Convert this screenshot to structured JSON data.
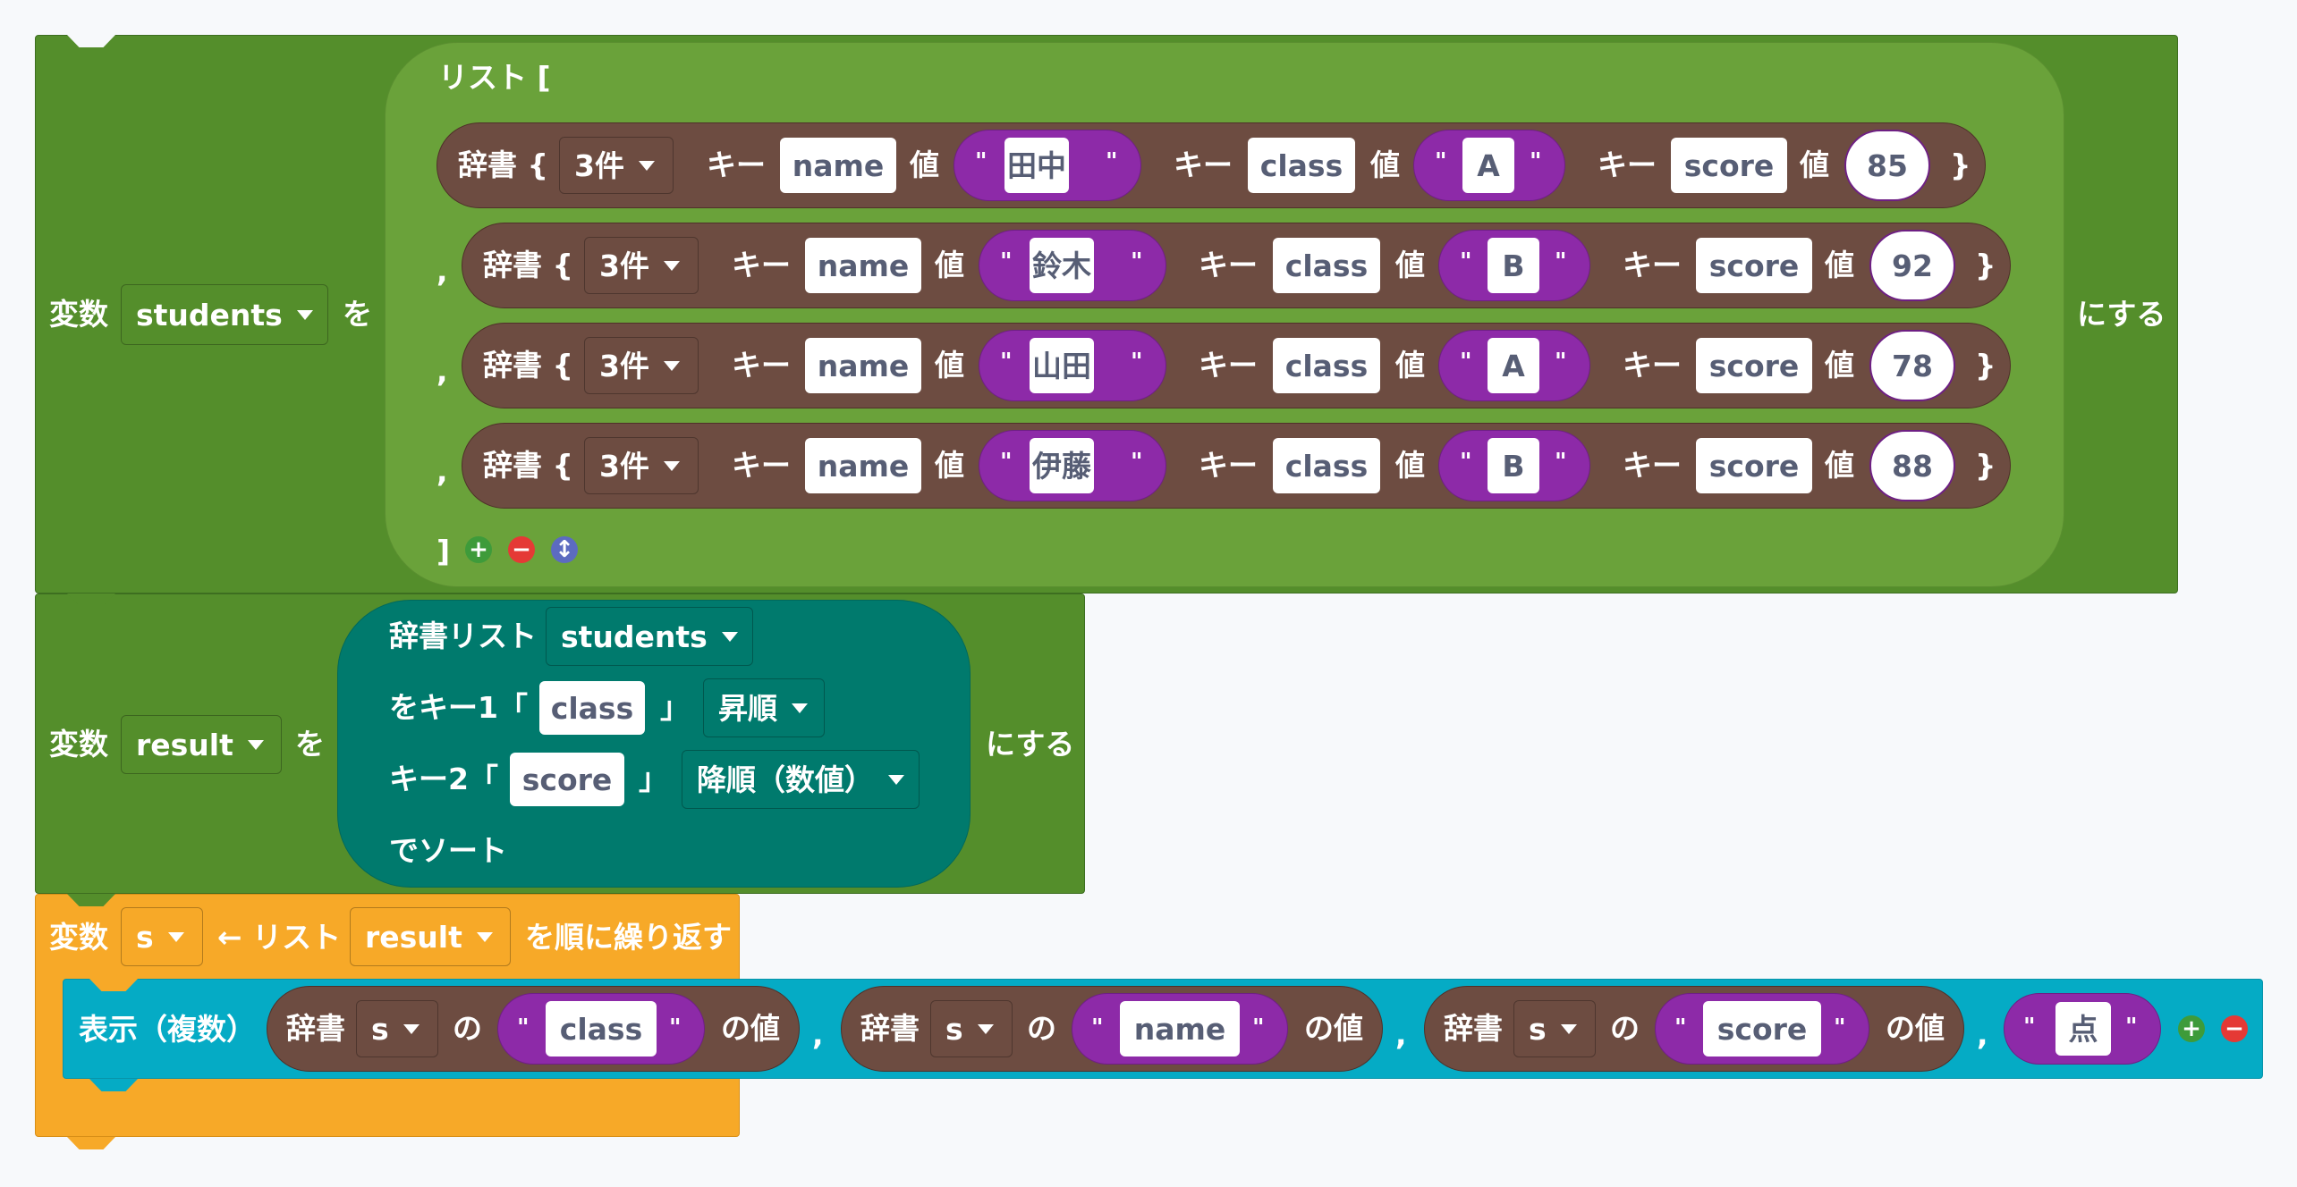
{
  "colors": {
    "variables": "#548e2b",
    "list": "#6aa23a",
    "dictionary": "#6d4c41",
    "string": "#8d2aa8",
    "sort": "#007a6d",
    "loop": "#f7a928",
    "print": "#05abc5",
    "background": "#f7f9fb"
  },
  "block1": {
    "var_label": "変数",
    "var_name": "students",
    "wo": "を",
    "nisuru": "にする",
    "list_open": "リスト [",
    "list_close": "]",
    "plus_icon": "+",
    "minus_icon": "−",
    "reorder_icon": "↕",
    "comma": ",",
    "dicts": [
      {
        "label": "辞書 {",
        "count": "3件",
        "key_label": "キー",
        "value_label": "値",
        "k1": "name",
        "v1": "田中",
        "k2": "class",
        "v2": "A",
        "k3": "score",
        "v3": "85",
        "close": "}"
      },
      {
        "label": "辞書 {",
        "count": "3件",
        "key_label": "キー",
        "value_label": "値",
        "k1": "name",
        "v1": "鈴木",
        "k2": "class",
        "v2": "B",
        "k3": "score",
        "v3": "92",
        "close": "}"
      },
      {
        "label": "辞書 {",
        "count": "3件",
        "key_label": "キー",
        "value_label": "値",
        "k1": "name",
        "v1": "山田",
        "k2": "class",
        "v2": "A",
        "k3": "score",
        "v3": "78",
        "close": "}"
      },
      {
        "label": "辞書 {",
        "count": "3件",
        "key_label": "キー",
        "value_label": "値",
        "k1": "name",
        "v1": "伊藤",
        "k2": "class",
        "v2": "B",
        "k3": "score",
        "v3": "88",
        "close": "}"
      }
    ]
  },
  "block2": {
    "var_label": "変数",
    "var_name": "result",
    "wo": "を",
    "nisuru": "にする",
    "sort": {
      "list_label": "辞書リスト",
      "list_var": "students",
      "key1_prefix": "をキー1「",
      "key1": "class",
      "bracket_close": "」",
      "order1": "昇順",
      "key2_prefix": "キー2「",
      "key2": "score",
      "order2": "降順（数値）",
      "suffix": "でソート"
    }
  },
  "block3": {
    "var_label": "変数",
    "var_name": "s",
    "arrow_list": "← リスト",
    "list_var": "result",
    "suffix": "を順に繰り返す",
    "print": {
      "label": "表示（複数）",
      "comma": ",",
      "items": [
        {
          "dict_label": "辞書",
          "var": "s",
          "no": "の",
          "key": "class",
          "value_label": "の値"
        },
        {
          "dict_label": "辞書",
          "var": "s",
          "no": "の",
          "key": "name",
          "value_label": "の値"
        },
        {
          "dict_label": "辞書",
          "var": "s",
          "no": "の",
          "key": "score",
          "value_label": "の値"
        }
      ],
      "last_string": "点",
      "plus_icon": "+",
      "minus_icon": "−"
    }
  }
}
